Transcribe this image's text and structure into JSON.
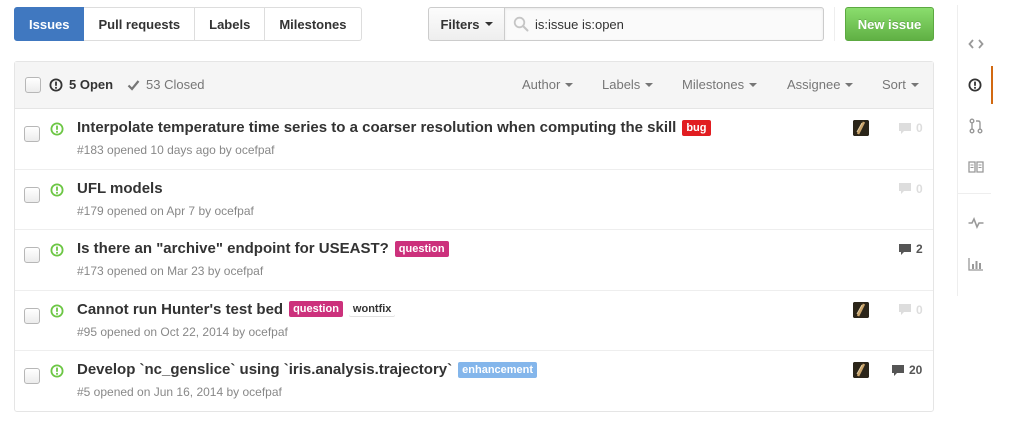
{
  "subnav": {
    "items": [
      {
        "label": "Issues",
        "selected": true
      },
      {
        "label": "Pull requests",
        "selected": false
      },
      {
        "label": "Labels",
        "selected": false
      },
      {
        "label": "Milestones",
        "selected": false
      }
    ]
  },
  "filters": {
    "button_label": "Filters",
    "search_value": "is:issue is:open"
  },
  "new_issue_label": "New issue",
  "table_header": {
    "open_label": "5 Open",
    "closed_label": "53 Closed",
    "filters": [
      {
        "label": "Author"
      },
      {
        "label": "Labels"
      },
      {
        "label": "Milestones"
      },
      {
        "label": "Assignee"
      },
      {
        "label": "Sort"
      }
    ]
  },
  "issues": [
    {
      "title": "Interpolate temperature time series to a coarser resolution when computing the skill",
      "labels": [
        {
          "text": "bug",
          "color": "#e11d21",
          "plain": false
        }
      ],
      "meta_prefix": "#183 opened 10 days ago by",
      "author": "ocefpaf",
      "has_avatar": true,
      "comments": "0",
      "comments_muted": true
    },
    {
      "title": "UFL models",
      "labels": [],
      "meta_prefix": "#179 opened on Apr 7 by",
      "author": "ocefpaf",
      "has_avatar": false,
      "comments": "0",
      "comments_muted": true
    },
    {
      "title": "Is there an \"archive\" endpoint for USEAST?",
      "labels": [
        {
          "text": "question",
          "color": "#cc317c",
          "plain": false
        }
      ],
      "meta_prefix": "#173 opened on Mar 23 by",
      "author": "ocefpaf",
      "has_avatar": false,
      "comments": "2",
      "comments_muted": false
    },
    {
      "title": "Cannot run Hunter's test bed",
      "labels": [
        {
          "text": "question",
          "color": "#cc317c",
          "plain": false
        },
        {
          "text": "wontfix",
          "color": "#ffffff",
          "plain": true
        }
      ],
      "meta_prefix": "#95 opened on Oct 22, 2014 by",
      "author": "ocefpaf",
      "has_avatar": true,
      "comments": "0",
      "comments_muted": true
    },
    {
      "title": "Develop `nc_genslice` using `iris.analysis.trajectory`",
      "labels": [
        {
          "text": "enhancement",
          "color": "#84b6eb",
          "plain": false
        }
      ],
      "meta_prefix": "#5 opened on Jun 16, 2014 by",
      "author": "ocefpaf",
      "has_avatar": true,
      "comments": "20",
      "comments_muted": false
    }
  ],
  "sidebar": {
    "items": [
      {
        "icon": "code-icon",
        "selected": false
      },
      {
        "icon": "issue-opened-icon",
        "selected": true
      },
      {
        "icon": "git-pull-request-icon",
        "selected": false
      },
      {
        "icon": "book-icon",
        "selected": false
      },
      {
        "icon": "pulse-icon",
        "selected": false
      },
      {
        "icon": "graph-icon",
        "selected": false
      }
    ]
  },
  "colors": {
    "accent_blue": "#4078c0",
    "open_green": "#6cc644",
    "new_issue_green": "#60b044",
    "sidebar_selected": "#d26911"
  }
}
